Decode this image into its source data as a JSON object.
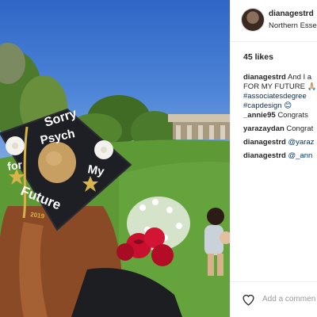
{
  "post": {
    "username": "dianagestrd",
    "location": "Northern Esse",
    "likes": "45 likes",
    "caption": {
      "author": "dianagestrd",
      "line1": "And I a",
      "line2": "FOR MY FUTURE 🙏🏼",
      "line3": "#associatesdegree",
      "line4": "#capdesign 😊"
    },
    "comments": [
      {
        "author": "_annie95",
        "text": "Congrats"
      },
      {
        "author": "yarazaydan",
        "text": "Congrat"
      },
      {
        "author": "dianagestrd",
        "text": "@yaraz"
      },
      {
        "author": "dianagestrd",
        "text": "@_ann"
      }
    ],
    "add_comment_placeholder": "Add a commen"
  },
  "cap": {
    "line1": "Sorry",
    "line2": "Psych",
    "word_left": "for",
    "word_right": "My",
    "word_bottom": "Future",
    "year": "2019"
  },
  "colors": {
    "sky": "#3a71cc",
    "grass": "#5b8c3a",
    "cap": "#1e1f25",
    "hashtag": "#003569"
  }
}
